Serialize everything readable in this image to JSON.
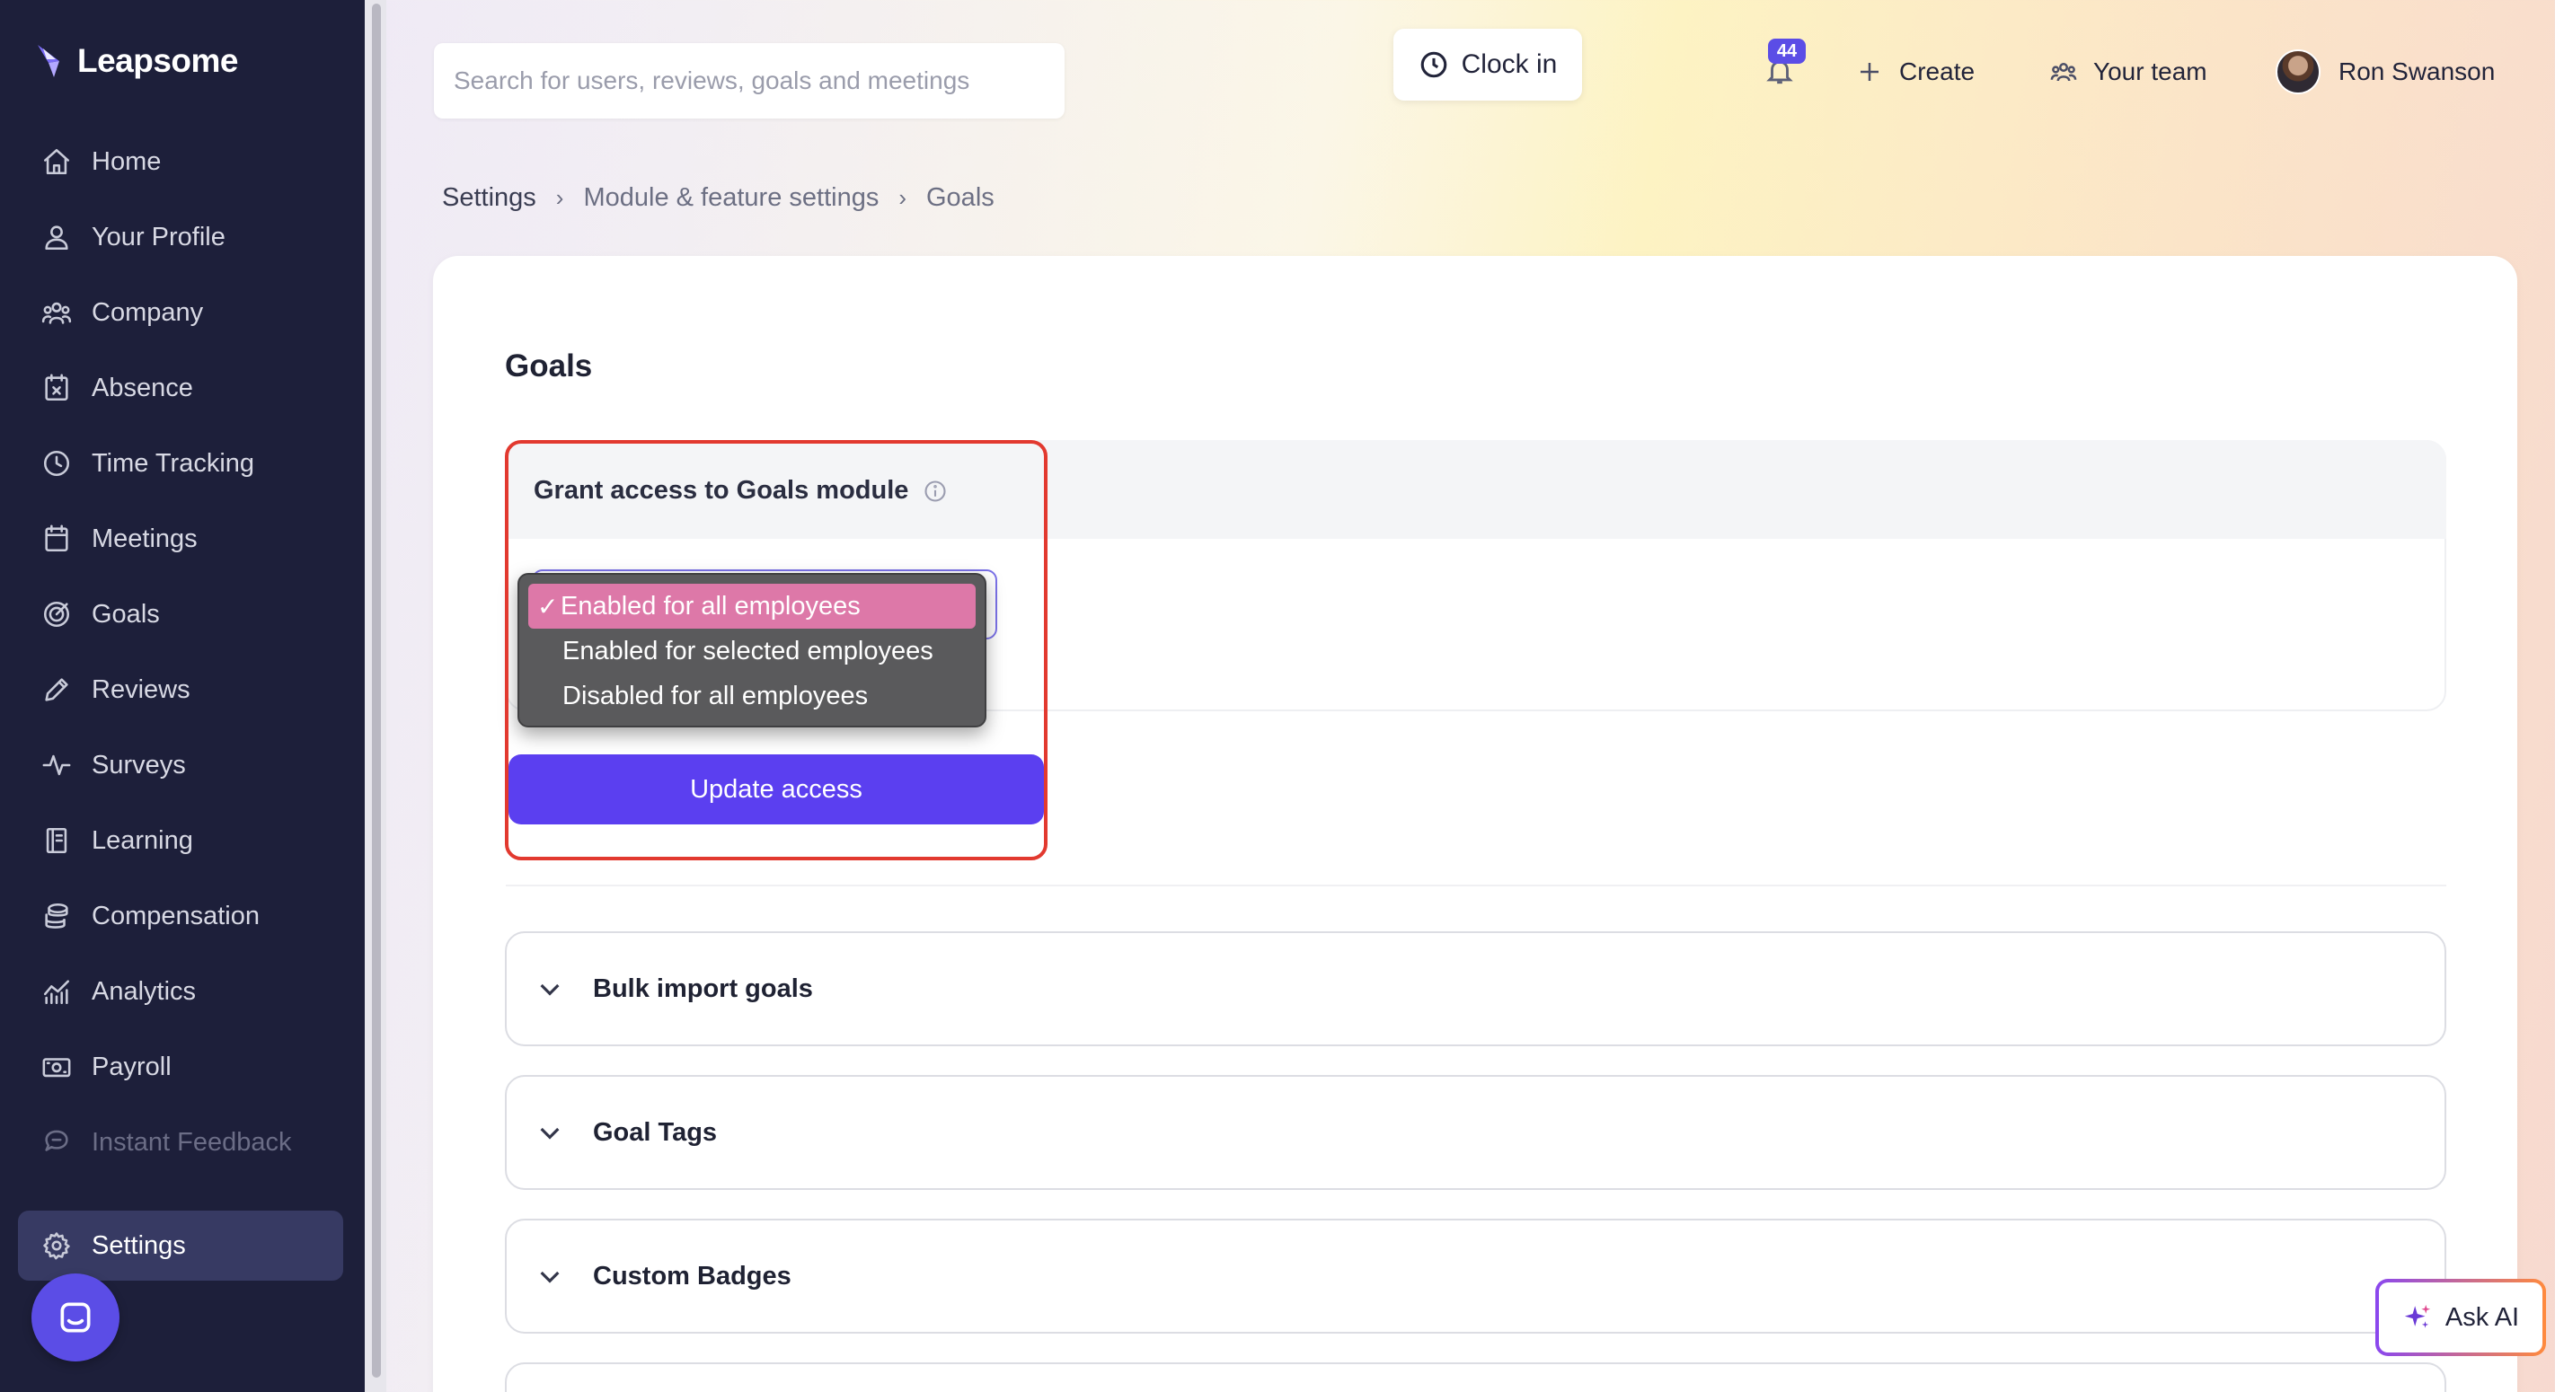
{
  "app": {
    "logo_text": "Leapsome"
  },
  "sidebar": {
    "items": [
      {
        "label": "Home",
        "icon": "home-icon"
      },
      {
        "label": "Your Profile",
        "icon": "user-icon"
      },
      {
        "label": "Company",
        "icon": "users-icon"
      },
      {
        "label": "Absence",
        "icon": "calendar-x-icon"
      },
      {
        "label": "Time Tracking",
        "icon": "clock-icon"
      },
      {
        "label": "Meetings",
        "icon": "calendar-icon"
      },
      {
        "label": "Goals",
        "icon": "target-icon"
      },
      {
        "label": "Reviews",
        "icon": "pencil-icon"
      },
      {
        "label": "Surveys",
        "icon": "pulse-icon"
      },
      {
        "label": "Learning",
        "icon": "book-icon"
      },
      {
        "label": "Compensation",
        "icon": "coins-icon"
      },
      {
        "label": "Analytics",
        "icon": "chart-icon"
      },
      {
        "label": "Payroll",
        "icon": "money-icon"
      },
      {
        "label": "Instant Feedback",
        "icon": "chat-icon"
      }
    ],
    "settings_label": "Settings"
  },
  "topbar": {
    "search_placeholder": "Search for users, reviews, goals and meetings",
    "clock_in_label": "Clock in",
    "notification_count": "44",
    "create_label": "Create",
    "your_team_label": "Your team",
    "user_name": "Ron Swanson"
  },
  "breadcrumb": [
    "Settings",
    "Module & feature settings",
    "Goals"
  ],
  "page": {
    "title": "Goals",
    "access": {
      "title": "Grant access to Goals module",
      "options": [
        "Enabled for all employees",
        "Enabled for selected employees",
        "Disabled for all employees"
      ],
      "selected_check": "✓",
      "update_label": "Update access"
    },
    "sections": [
      "Bulk import goals",
      "Goal Tags",
      "Custom Badges"
    ]
  },
  "ask_ai_label": "Ask AI",
  "colors": {
    "sidebar_bg": "#1d1f3a",
    "primary": "#5b3ff0",
    "highlight": "#e2392f",
    "selected_option": "#dd78a8"
  }
}
